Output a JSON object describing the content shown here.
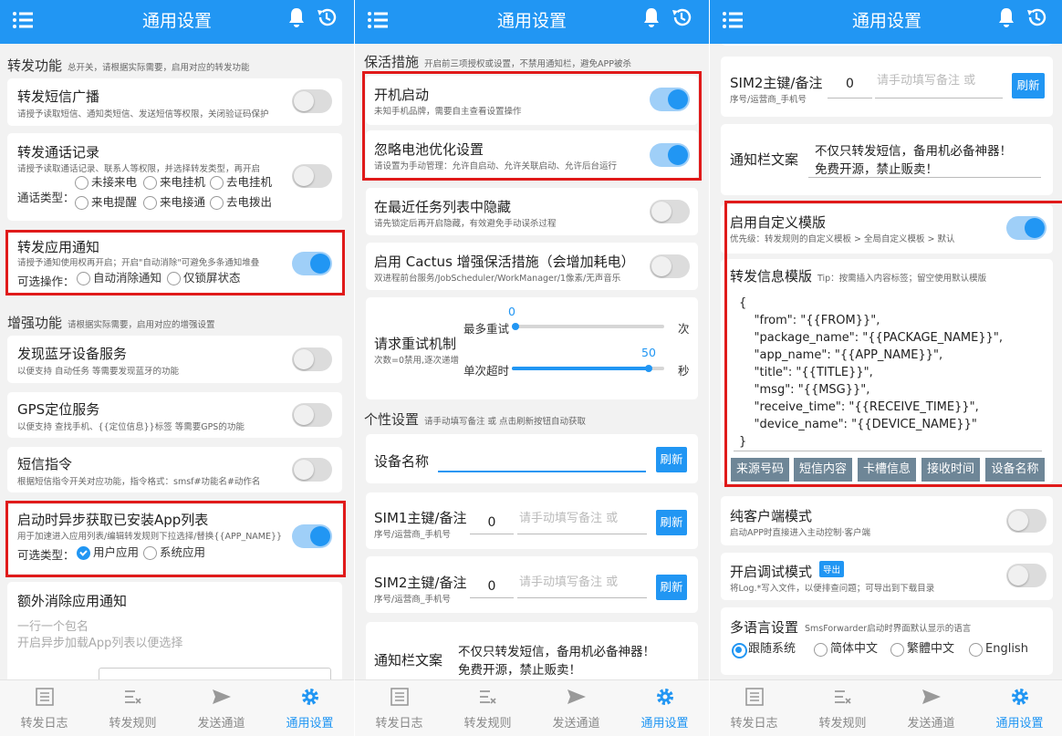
{
  "app": {
    "title": "通用设置"
  },
  "nav": {
    "items": [
      "转发日志",
      "转发规则",
      "发送通道",
      "通用设置"
    ]
  },
  "p1": {
    "sec_forward": {
      "title": "转发功能",
      "desc": "总开关，请根据实际需要，启用对应的转发功能"
    },
    "sms": {
      "title": "转发短信广播",
      "desc": "请授予读取短信、通知类短信、发送短信等权限，关闭验证码保护"
    },
    "call": {
      "title": "转发通话记录",
      "desc": "请授予读取通话记录、联系人等权限，并选择转发类型，再开启",
      "type_label": "通话类型：",
      "types": [
        "未接来电",
        "来电挂机",
        "去电挂机",
        "来电提醒",
        "来电接通",
        "去电拨出"
      ]
    },
    "app_notify": {
      "title": "转发应用通知",
      "desc": "请授予通知使用权再开启；开启\"自动消除\"可避免多条通知堆叠",
      "ops_label": "可选操作：",
      "ops": [
        "自动消除通知",
        "仅锁屏状态"
      ]
    },
    "sec_enhance": {
      "title": "增强功能",
      "desc": "请根据实际需要，启用对应的增强设置"
    },
    "bt": {
      "title": "发现蓝牙设备服务",
      "desc": "以便支持 自动任务 等需要发现蓝牙的功能"
    },
    "gps": {
      "title": "GPS定位服务",
      "desc": "以便支持 查找手机、{{定位信息}}标签 等需要GPS的功能"
    },
    "smscmd": {
      "title": "短信指令",
      "desc": "根据短信指令开关对应功能，指令格式：smsf#功能名#动作名"
    },
    "applist": {
      "title": "启动时异步获取已安装App列表",
      "desc": "用于加速进入应用列表/编辑转发规则下拉选择/替换{{APP_NAME}}",
      "type_label": "可选类型：",
      "types": [
        "用户应用",
        "系统应用"
      ]
    },
    "extra": {
      "title": "额外消除应用通知",
      "ph1": "一行一个包名",
      "ph2": "开启异步加载App列表以便选择"
    }
  },
  "p2": {
    "sec_keep": {
      "title": "保活措施",
      "desc": "开启前三项授权或设置，不禁用通知栏，避免APP被杀"
    },
    "boot": {
      "title": "开机启动",
      "desc": "未知手机品牌，需要自主查看设置操作"
    },
    "battery": {
      "title": "忽略电池优化设置",
      "desc": "请设置为手动管理：允许自启动、允许关联启动、允许后台运行"
    },
    "recent": {
      "title": "在最近任务列表中隐藏",
      "desc": "请先锁定后再开启隐藏，有效避免手动误杀过程"
    },
    "cactus": {
      "title": "启用 Cactus 增强保活措施（会增加耗电）",
      "desc": "双进程前台服务/JobScheduler/WorkManager/1像素/无声音乐"
    },
    "retry": {
      "title": "请求重试机制",
      "desc": "次数=0禁用,逐次递增",
      "max_label": "最多重试",
      "max_value": "0",
      "max_unit": "次",
      "timeout_label": "单次超时",
      "timeout_value": "50",
      "timeout_unit": "秒",
      "max_frac": 0,
      "timeout_frac": 0.9
    },
    "sec_personal": {
      "title": "个性设置",
      "desc": "请手动填写备注 或 点击刷新按钮自动获取"
    },
    "device": {
      "label": "设备名称",
      "refresh": "刷新"
    },
    "sim1": {
      "label": "SIM1主键/备注",
      "desc": "序号/运营商_手机号",
      "value": "0",
      "placeholder": "请手动填写备注 或",
      "refresh": "刷新"
    },
    "sim2": {
      "label": "SIM2主键/备注",
      "desc": "序号/运营商_手机号",
      "value": "0",
      "placeholder": "请手动填写备注 或",
      "refresh": "刷新"
    },
    "notify_text": {
      "label": "通知栏文案",
      "line1": "不仅只转发短信，备用机必备神器！",
      "line2": "免费开源，禁止贩卖！"
    }
  },
  "p3": {
    "sim2": {
      "label": "SIM2主键/备注",
      "desc": "序号/运营商_手机号",
      "value": "0",
      "placeholder": "请手动填写备注 或",
      "refresh": "刷新"
    },
    "notify_text": {
      "label": "通知栏文案",
      "line1": "不仅只转发短信，备用机必备神器！",
      "line2": "免费开源，禁止贩卖！"
    },
    "custom_tpl": {
      "title": "启用自定义模版",
      "desc": "优先级：转发规则的自定义模板 > 全局自定义模板 > 默认"
    },
    "tpl": {
      "title": "转发信息模版",
      "tip": "Tip：按需插入内容标签；留空使用默认模版",
      "lines": [
        "{",
        "    \"from\": \"{{FROM}}\",",
        "    \"package_name\": \"{{PACKAGE_NAME}}\",",
        "    \"app_name\": \"{{APP_NAME}}\",",
        "    \"title\": \"{{TITLE}}\",",
        "    \"msg\": \"{{MSG}}\",",
        "    \"receive_time\": \"{{RECEIVE_TIME}}\",",
        "    \"device_name\": \"{{DEVICE_NAME}}\"",
        "}"
      ],
      "tags": [
        "来源号码",
        "短信内容",
        "卡槽信息",
        "接收时间",
        "设备名称"
      ]
    },
    "client": {
      "title": "纯客户端模式",
      "desc": "启动APP时直接进入主动控制·客户端"
    },
    "debug": {
      "title": "开启调试模式",
      "export": "导出",
      "desc": "将Log.*写入文件，以便排查问题；可导出到下载目录"
    },
    "lang": {
      "title": "多语言设置",
      "desc": "SmsForwarder启动时界面默认显示的语言",
      "options": [
        "跟随系统",
        "简体中文",
        "繁體中文",
        "English"
      ]
    }
  },
  "colors": {
    "primary": "#2196f3",
    "highlight": "#e01a1a",
    "tag_button": "#6e8697"
  }
}
